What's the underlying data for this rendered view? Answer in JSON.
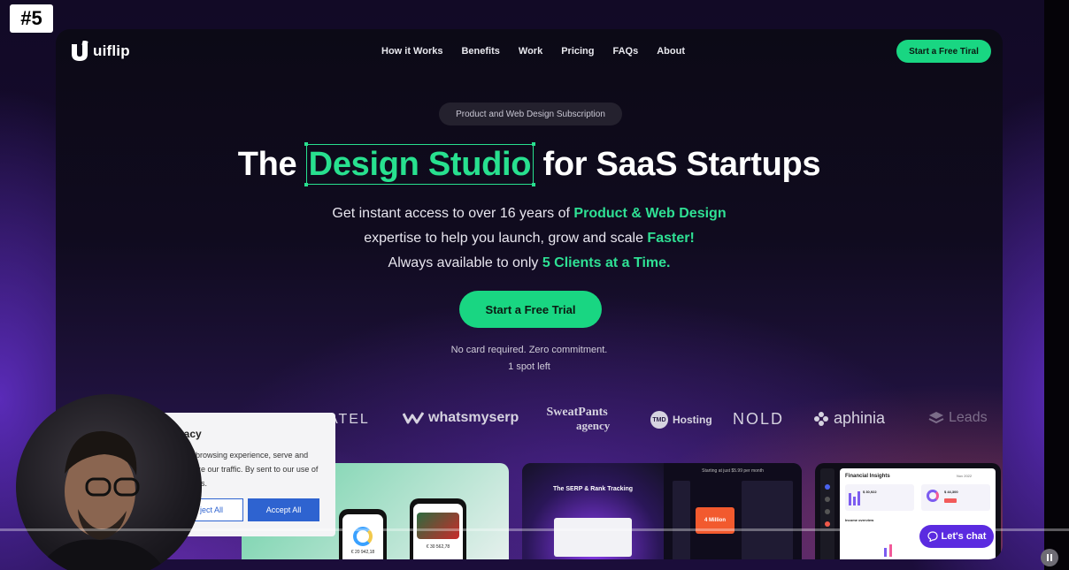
{
  "episode": {
    "label": "#5"
  },
  "site": {
    "logo_text": "uiflip",
    "nav": [
      {
        "label": "How it Works"
      },
      {
        "label": "Benefits"
      },
      {
        "label": "Work"
      },
      {
        "label": "Pricing"
      },
      {
        "label": "FAQs"
      },
      {
        "label": "About"
      }
    ],
    "nav_cta": "Start a Free Tiral",
    "pill": "Product and Web Design Subscription",
    "headline": {
      "before": "The",
      "accent": "Design Studio",
      "after": "for SaaS Startups"
    },
    "sub": {
      "line1_a": "Get instant access to over 16 years of ",
      "line1_b": "Product & Web Design",
      "line2_a": "expertise to help you launch, grow and scale ",
      "line2_b": "Faster!",
      "line3_a": "Always available to only ",
      "line3_b": "5 Clients at a Time."
    },
    "hero_cta": "Start a Free Trial",
    "note1": "No card required. Zero commitment.",
    "note2": "1 spot left",
    "brands": {
      "atel": "ATEL",
      "whatsmyserp": "whatsmyserp",
      "sweatpants_1": "SweatPants",
      "sweatpants_2": "agency",
      "tmdhosting_mark": "TMD",
      "tmdhosting": "Hosting",
      "nold": "NOLD",
      "aphinia": "aphinia",
      "leadster": "Leads"
    },
    "shots": {
      "serp_title": "The SERP & Rank Tracking",
      "pricing_title": "Starting at just $5.99 per month",
      "price_value": "4 Million",
      "phone_value": "€ 20 942,18",
      "phone_value_2": "€ 30 562,78",
      "fin_title": "Financial Insights",
      "fin_value_1": "$ 30,922",
      "fin_value_2": "$ 44,300",
      "fin_section": "Income overview",
      "fin_filter": "Nov 2022"
    },
    "chat_button": "Let's chat"
  },
  "cookie": {
    "title": "vacy",
    "text": "your browsing experience, serve and analyze our traffic. By sent to our use of cookies.",
    "reject": "ject All",
    "accept": "Accept All"
  },
  "colors": {
    "accent_green": "#19d682",
    "purple": "#5b2be0",
    "cookie_blue": "#2e63d0"
  }
}
